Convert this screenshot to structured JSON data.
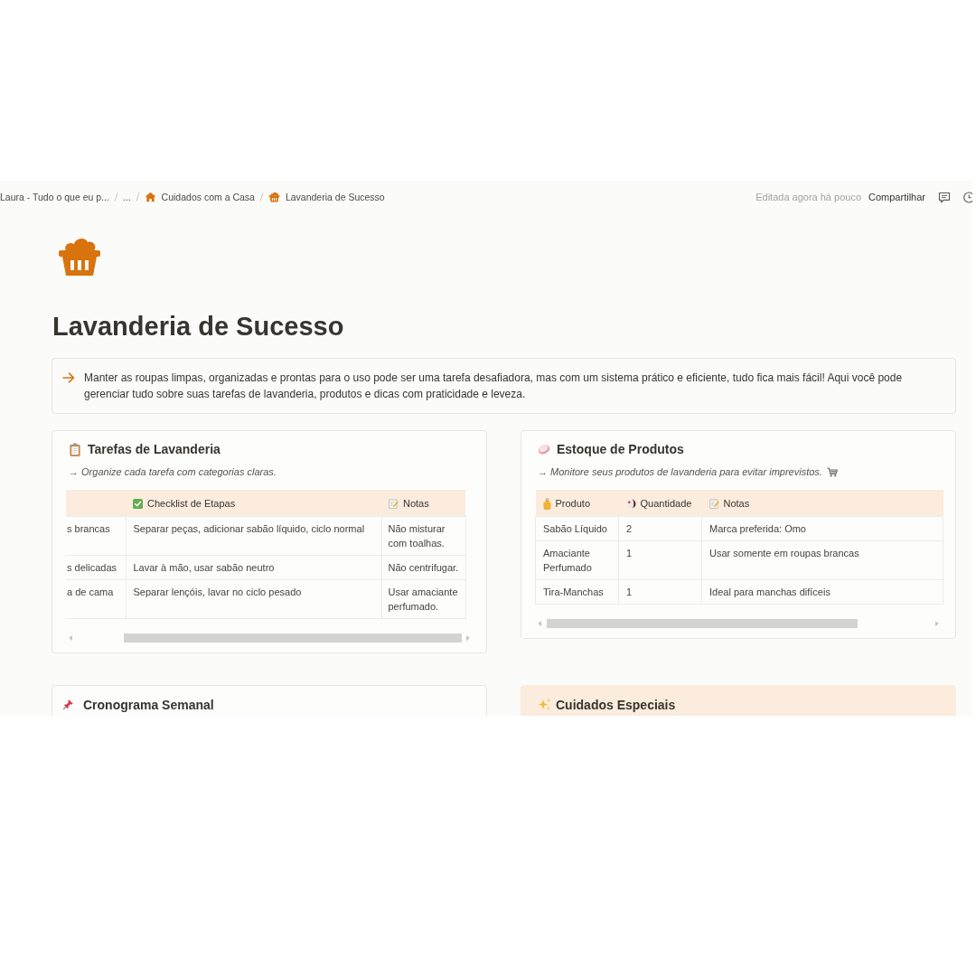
{
  "breadcrumbs": [
    {
      "label": "Laura - Tudo o que eu p..."
    },
    {
      "label": "..."
    },
    {
      "label": "Cuidados com a Casa"
    },
    {
      "label": "Lavanderia de Sucesso"
    }
  ],
  "top_bar": {
    "edited_status": "Editada agora há pouco",
    "share_label": "Compartilhar"
  },
  "page": {
    "title": "Lavanderia de Sucesso",
    "callout": "Manter as roupas limpas, organizadas e prontas para o uso pode ser uma tarefa desafiadora, mas com um sistema prático e eficiente, tudo fica mais fácil! Aqui você pode gerenciar tudo sobre suas tarefas de lavanderia, produtos e dicas com praticidade e leveza."
  },
  "cards": [
    {
      "title": "Tarefas de Lavanderia",
      "highlighted": false,
      "subtitle": "→ Organize cada tarefa com categorias claras.",
      "table": {
        "columns": [
          {
            "kind": "clipped"
          },
          {
            "kind": "titled",
            "label": "Checklist de Etapas"
          },
          {
            "kind": "titled",
            "label": "Notas"
          }
        ],
        "rows": [
          [
            "s brancas",
            "Separar peças, adicionar sabão líquido, ciclo normal",
            "Não misturar com toalhas."
          ],
          [
            "s delicadas",
            "Lavar à mão, usar sabão neutro",
            "Não centrifugar."
          ],
          [
            "a de cama",
            "Separar lençóis, lavar no ciclo pesado",
            "Usar amaciante perfumado."
          ]
        ]
      }
    },
    {
      "title": "Estoque de Produtos",
      "highlighted": false,
      "subtitle": "→ Monitore seus produtos de lavanderia para evitar imprevistos.",
      "table": {
        "columns": [
          {
            "kind": "titled",
            "label": "Produto"
          },
          {
            "kind": "titled",
            "label": "Quantidade"
          },
          {
            "kind": "titled",
            "label": "Notas"
          }
        ],
        "rows": [
          [
            "Sabão Líquido",
            "2",
            "Marca preferida: Omo"
          ],
          [
            "Amaciante Perfumado",
            "1",
            "Usar somente em roupas brancas"
          ],
          [
            "Tira-Manchas",
            "1",
            "Ideal para manchas difíceis"
          ]
        ]
      }
    }
  ],
  "more_cards": [
    {
      "title": "Cronograma Semanal",
      "highlighted": false
    },
    {
      "title": "Cuidados Especiais",
      "highlighted": true
    }
  ]
}
